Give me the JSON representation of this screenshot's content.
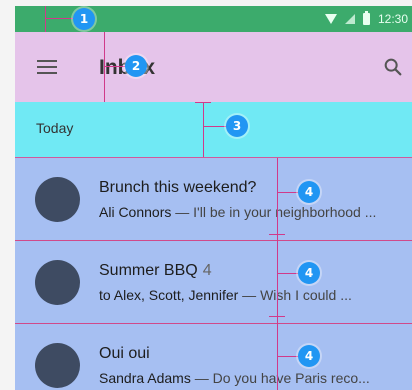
{
  "status_bar": {
    "time": "12:30"
  },
  "toolbar": {
    "title": "Inbox"
  },
  "section": {
    "label": "Today"
  },
  "messages": [
    {
      "title": "Brunch this weekend?",
      "count": "",
      "sender": "Ali Connors",
      "preview": " — I'll be in your neighborhood ..."
    },
    {
      "title": "Summer BBQ",
      "count": "4",
      "sender": "to Alex, Scott, Jennifer",
      "preview": " — Wish I could ..."
    },
    {
      "title": "Oui oui",
      "count": "",
      "sender": "Sandra Adams",
      "preview": " — Do you have Paris reco..."
    }
  ],
  "annotations": {
    "badge_1": "1",
    "badge_2": "2",
    "badge_3": "3",
    "badge_4": "4"
  },
  "colors": {
    "status_bar": "#3cab6c",
    "toolbar": "#e5c4ea",
    "section_header": "#70e9f4",
    "list_row": "#a6bff2",
    "avatar": "#3e4b62",
    "guide_line": "#d03a8a",
    "badge": "#2196f3"
  }
}
